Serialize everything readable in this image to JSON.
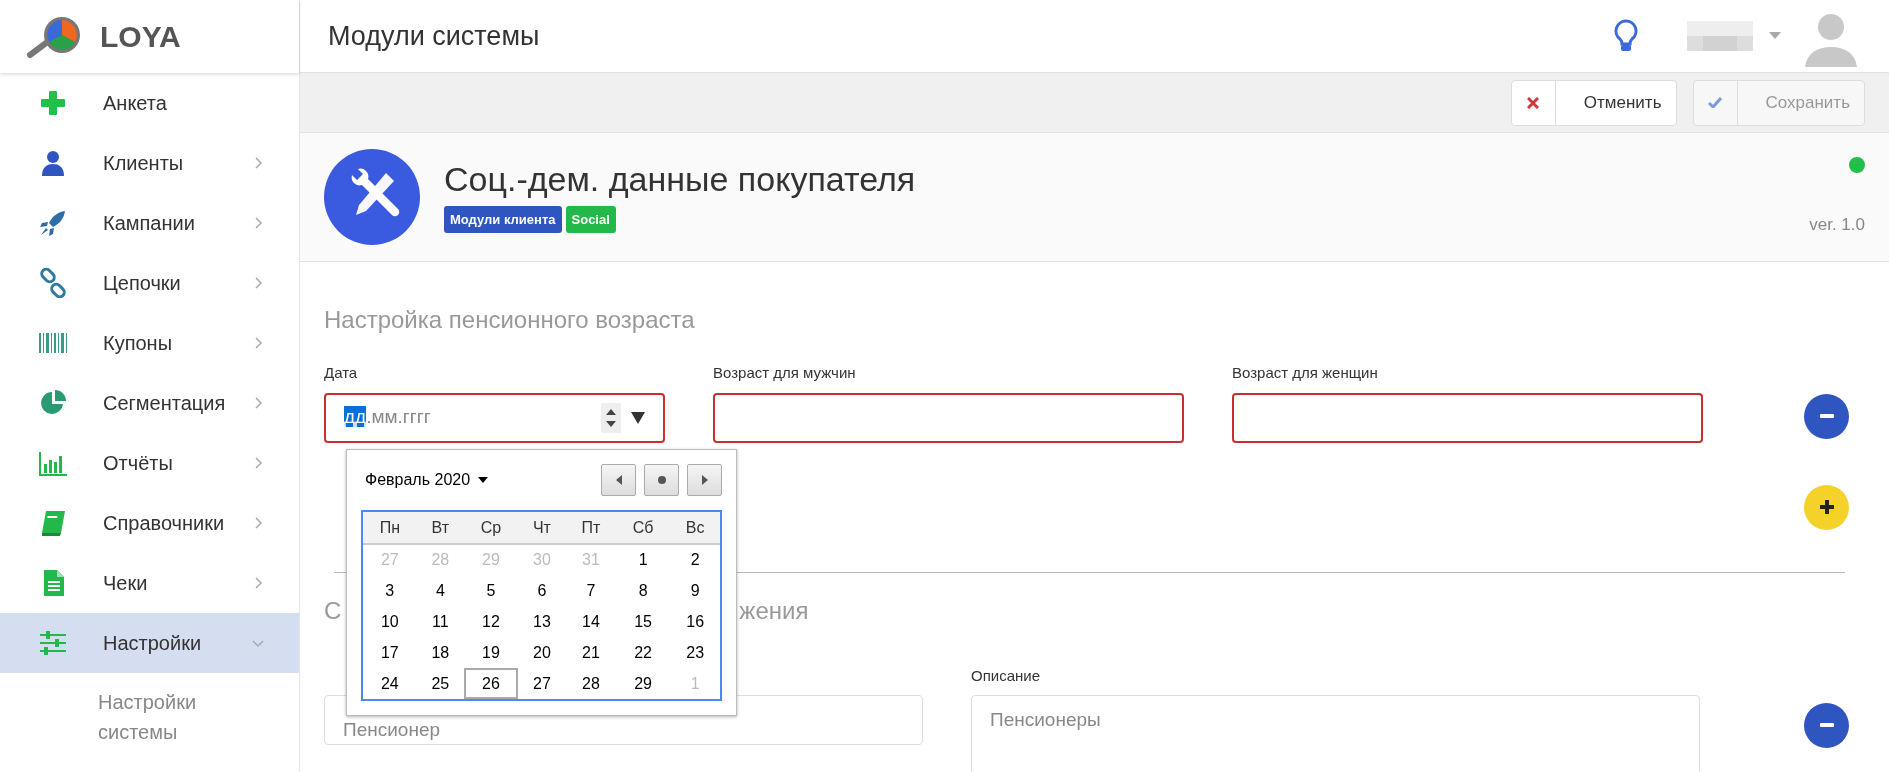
{
  "brand": {
    "name": "LOYA"
  },
  "sidebar": {
    "items": [
      {
        "label": "Анкета",
        "has_children": false,
        "selected": false
      },
      {
        "label": "Клиенты",
        "has_children": true,
        "expanded": false,
        "selected": false
      },
      {
        "label": "Кампании",
        "has_children": true,
        "expanded": false,
        "selected": false
      },
      {
        "label": "Цепочки",
        "has_children": true,
        "expanded": false,
        "selected": false
      },
      {
        "label": "Купоны",
        "has_children": true,
        "expanded": false,
        "selected": false
      },
      {
        "label": "Сегментация",
        "has_children": true,
        "expanded": false,
        "selected": false
      },
      {
        "label": "Отчёты",
        "has_children": true,
        "expanded": false,
        "selected": false
      },
      {
        "label": "Справочники",
        "has_children": true,
        "expanded": false,
        "selected": false
      },
      {
        "label": "Чеки",
        "has_children": true,
        "expanded": false,
        "selected": false
      },
      {
        "label": "Настройки",
        "has_children": true,
        "expanded": true,
        "selected": true,
        "children": [
          {
            "label": "Настройки системы"
          }
        ]
      }
    ]
  },
  "header": {
    "title": "Модули системы"
  },
  "toolbar": {
    "buttons": [
      {
        "label": "Отменить",
        "kind": "cancel",
        "disabled": false
      },
      {
        "label": "Сохранить",
        "kind": "save",
        "disabled": true
      }
    ]
  },
  "module": {
    "title": "Соц.-дем. данные покупателя",
    "tags": [
      {
        "label": "Модули клиента",
        "color": "#2f55c0"
      },
      {
        "label": "Social",
        "color": "#22b94a"
      }
    ],
    "active": true,
    "version": "ver. 1.0"
  },
  "section1": {
    "heading": "Настройка пенсионного возраста",
    "fields": [
      {
        "label": "Дата",
        "kind": "date",
        "invalid": true,
        "segments": [
          {
            "text": "дд",
            "selected": true
          },
          {
            "text": ".мм.гггг",
            "selected": false
          }
        ]
      },
      {
        "label": "Возраст для мужчин",
        "kind": "text",
        "invalid": true
      },
      {
        "label": "Возраст для женщин",
        "kind": "text",
        "invalid": true
      }
    ]
  },
  "calendar": {
    "month": "Февраль 2020",
    "weekdays": [
      "Пн",
      "Вт",
      "Ср",
      "Чт",
      "Пт",
      "Сб",
      "Вс"
    ],
    "weeks": [
      [
        {
          "day": "27",
          "other_month": true,
          "today": false
        },
        {
          "day": "28",
          "other_month": true,
          "today": false
        },
        {
          "day": "29",
          "other_month": true,
          "today": false
        },
        {
          "day": "30",
          "other_month": true,
          "today": false
        },
        {
          "day": "31",
          "other_month": true,
          "today": false
        },
        {
          "day": "1",
          "other_month": false,
          "today": false
        },
        {
          "day": "2",
          "other_month": false,
          "today": false
        }
      ],
      [
        {
          "day": "3",
          "other_month": false,
          "today": false
        },
        {
          "day": "4",
          "other_month": false,
          "today": false
        },
        {
          "day": "5",
          "other_month": false,
          "today": false
        },
        {
          "day": "6",
          "other_month": false,
          "today": false
        },
        {
          "day": "7",
          "other_month": false,
          "today": false
        },
        {
          "day": "8",
          "other_month": false,
          "today": false
        },
        {
          "day": "9",
          "other_month": false,
          "today": false
        }
      ],
      [
        {
          "day": "10",
          "other_month": false,
          "today": false
        },
        {
          "day": "11",
          "other_month": false,
          "today": false
        },
        {
          "day": "12",
          "other_month": false,
          "today": false
        },
        {
          "day": "13",
          "other_month": false,
          "today": false
        },
        {
          "day": "14",
          "other_month": false,
          "today": false
        },
        {
          "day": "15",
          "other_month": false,
          "today": false
        },
        {
          "day": "16",
          "other_month": false,
          "today": false
        }
      ],
      [
        {
          "day": "17",
          "other_month": false,
          "today": false
        },
        {
          "day": "18",
          "other_month": false,
          "today": false
        },
        {
          "day": "19",
          "other_month": false,
          "today": false
        },
        {
          "day": "20",
          "other_month": false,
          "today": false
        },
        {
          "day": "21",
          "other_month": false,
          "today": false
        },
        {
          "day": "22",
          "other_month": false,
          "today": false
        },
        {
          "day": "23",
          "other_month": false,
          "today": false
        }
      ],
      [
        {
          "day": "24",
          "other_month": false,
          "today": false
        },
        {
          "day": "25",
          "other_month": false,
          "today": false
        },
        {
          "day": "26",
          "other_month": false,
          "today": true
        },
        {
          "day": "27",
          "other_month": false,
          "today": false
        },
        {
          "day": "28",
          "other_month": false,
          "today": false
        },
        {
          "day": "29",
          "other_month": false,
          "today": false
        },
        {
          "day": "1",
          "other_month": true,
          "today": false
        }
      ]
    ]
  },
  "section2": {
    "heading_parts": [
      "С",
      "жения"
    ],
    "fields": [
      {
        "kind": "text",
        "value": "Пенсионер"
      },
      {
        "label": "Описание",
        "kind": "textarea",
        "value": "Пенсионеры"
      }
    ]
  }
}
